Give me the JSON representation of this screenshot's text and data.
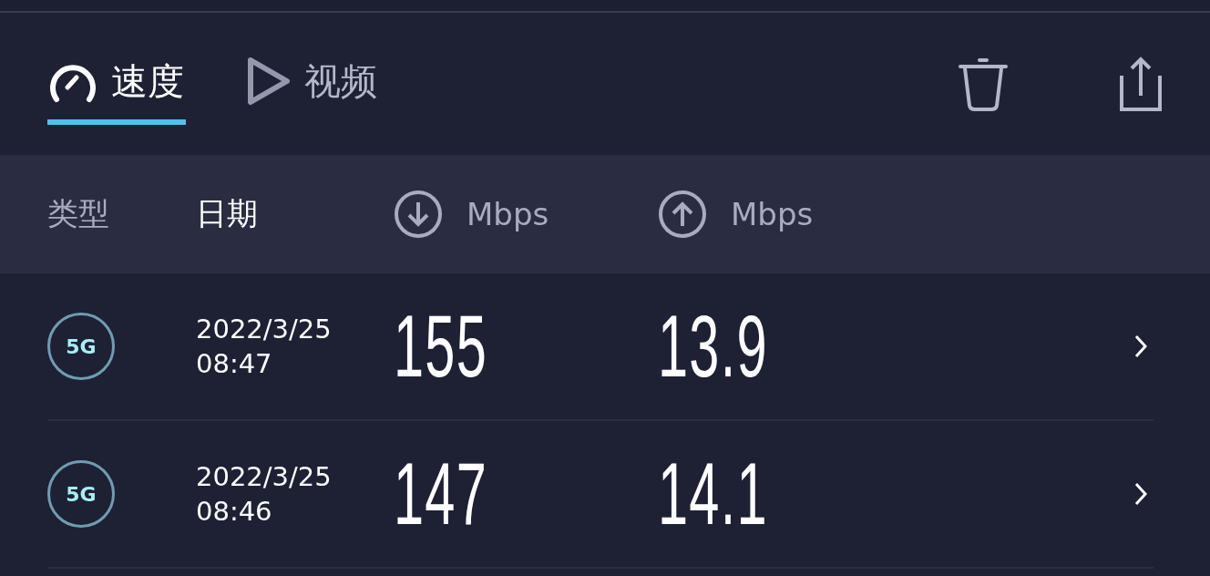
{
  "tabs": [
    {
      "kind": "speed",
      "label": "速度",
      "selected": true
    },
    {
      "kind": "video",
      "label": "视频",
      "selected": false
    }
  ],
  "actions": [
    {
      "kind": "delete"
    },
    {
      "kind": "share"
    }
  ],
  "columns": [
    {
      "kind": "text",
      "label": "类型",
      "selected": false
    },
    {
      "kind": "text",
      "label": "日期",
      "selected": true
    },
    {
      "kind": "download",
      "label": "Mbps",
      "selected": false
    },
    {
      "kind": "upload",
      "label": "Mbps",
      "selected": false
    }
  ],
  "results": [
    {
      "type": "5G",
      "date": "2022/3/25",
      "time": "08:47",
      "download": "155",
      "upload": "13.9"
    },
    {
      "type": "5G",
      "date": "2022/3/25",
      "time": "08:46",
      "download": "147",
      "upload": "14.1"
    }
  ]
}
